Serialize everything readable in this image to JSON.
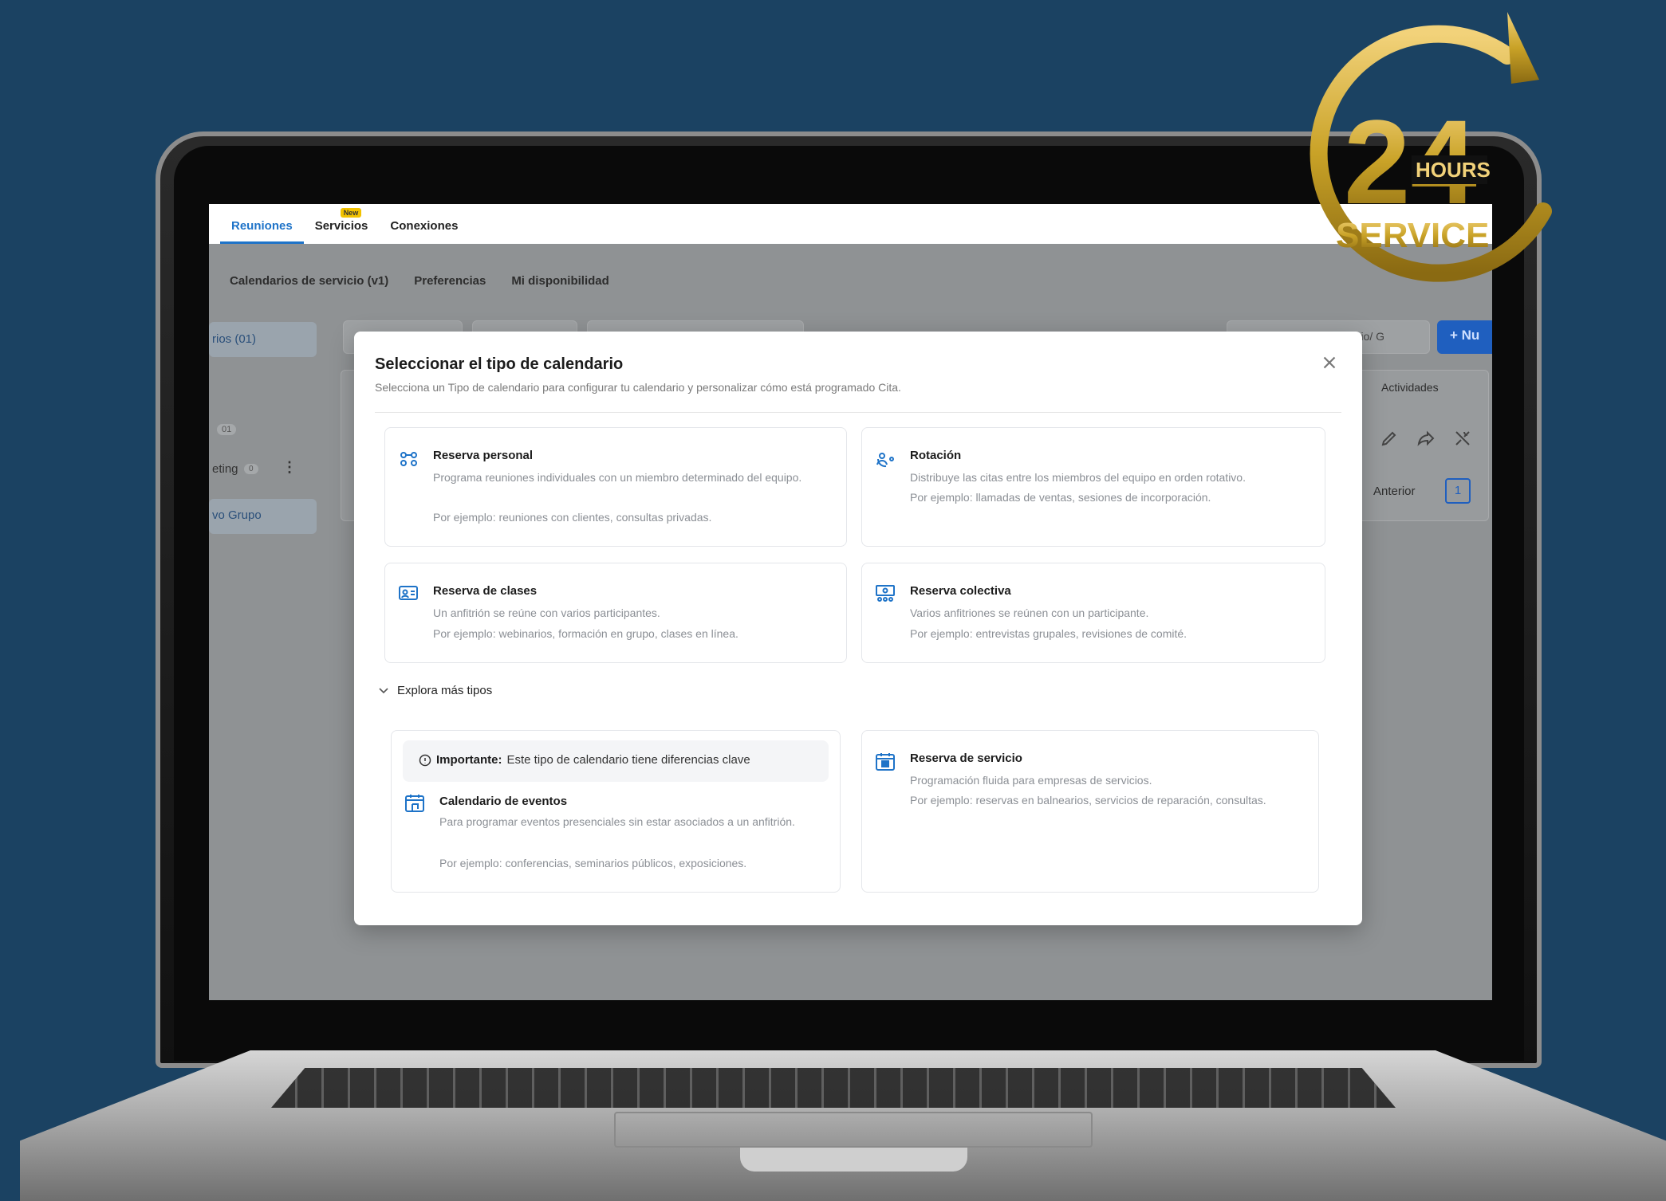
{
  "top_tabs": [
    {
      "label": "Reuniones",
      "active": true
    },
    {
      "label": "Servicios",
      "badge": "New"
    },
    {
      "label": "Conexiones"
    }
  ],
  "sub_tabs": [
    "Calendarios de servicio (v1)",
    "Preferencias",
    "Mi disponibilidad"
  ],
  "background": {
    "sidebar": {
      "group_label": "rios (01)",
      "count_badge": "01",
      "meeting_label": "eting",
      "meeting_badge": "0",
      "new_group": "vo Grupo"
    },
    "search_fragment": "erio/ G",
    "new_button": "+ Nu",
    "activities_header": "Actividades",
    "pager": {
      "prev": "Anterior",
      "current": "1"
    }
  },
  "modal": {
    "title": "Seleccionar el tipo de calendario",
    "subtitle": "Selecciona un Tipo de calendario para configurar tu calendario y personalizar cómo está programado Cita.",
    "cards": [
      {
        "icon": "personal-booking-icon",
        "title": "Reserva personal",
        "description": "Programa reuniones individuales con un miembro determinado del equipo.",
        "example": "Por ejemplo: reuniones con clientes, consultas privadas."
      },
      {
        "icon": "rotation-icon",
        "title": "Rotación",
        "description": "Distribuye las citas entre los miembros del equipo en orden rotativo.",
        "example": "Por ejemplo: llamadas de ventas, sesiones de incorporación."
      },
      {
        "icon": "class-booking-icon",
        "title": "Reserva de clases",
        "description": "Un anfitrión se reúne con varios participantes.",
        "example": "Por ejemplo: webinarios, formación en grupo, clases en línea."
      },
      {
        "icon": "collective-booking-icon",
        "title": "Reserva colectiva",
        "description": "Varios anfitriones se reúnen con un participante.",
        "example": "Por ejemplo: entrevistas grupales, revisiones de comité."
      }
    ],
    "explore_label": "Explora más tipos",
    "notice": {
      "strong": "Importante:",
      "text": "Este tipo de calendario tiene diferencias clave"
    },
    "event_card": {
      "icon": "event-calendar-icon",
      "title": "Calendario de eventos",
      "description": "Para programar eventos presenciales sin estar asociados a un anfitrión.",
      "example": "Por ejemplo: conferencias, seminarios públicos, exposiciones."
    },
    "service_card": {
      "icon": "service-booking-icon",
      "title": "Reserva de servicio",
      "description": "Programación fluida para empresas de servicios.",
      "example": "Por ejemplo: reservas en balnearios, servicios de reparación, consultas."
    }
  },
  "logo": {
    "number": "24",
    "hours": "HOURS",
    "service": "SERVICE"
  },
  "colors": {
    "background": "#1b4262",
    "accent": "#1e73c8",
    "gold": "#c9a227"
  }
}
